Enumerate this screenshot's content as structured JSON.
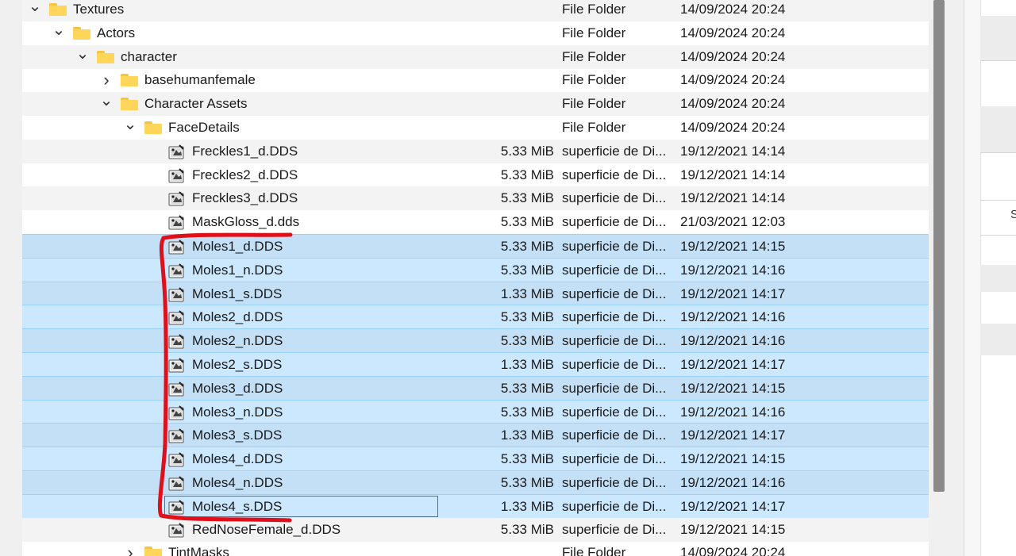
{
  "tree": {
    "rows": [
      {
        "name": "Textures",
        "kind": "folder",
        "indent": 0,
        "chevron": "expanded",
        "size": "",
        "type": "File Folder",
        "date": "14/09/2024 20:24",
        "selected": false
      },
      {
        "name": "Actors",
        "kind": "folder",
        "indent": 1,
        "chevron": "expanded",
        "size": "",
        "type": "File Folder",
        "date": "14/09/2024 20:24",
        "selected": false
      },
      {
        "name": "character",
        "kind": "folder",
        "indent": 2,
        "chevron": "expanded",
        "size": "",
        "type": "File Folder",
        "date": "14/09/2024 20:24",
        "selected": false
      },
      {
        "name": "basehumanfemale",
        "kind": "folder",
        "indent": 3,
        "chevron": "collapsed",
        "size": "",
        "type": "File Folder",
        "date": "14/09/2024 20:24",
        "selected": false
      },
      {
        "name": "Character Assets",
        "kind": "folder",
        "indent": 3,
        "chevron": "expanded",
        "size": "",
        "type": "File Folder",
        "date": "14/09/2024 20:24",
        "selected": false
      },
      {
        "name": "FaceDetails",
        "kind": "folder",
        "indent": 4,
        "chevron": "expanded",
        "size": "",
        "type": "File Folder",
        "date": "14/09/2024 20:24",
        "selected": false
      },
      {
        "name": "Freckles1_d.DDS",
        "kind": "file",
        "indent": 5,
        "chevron": "",
        "size": "5.33 MiB",
        "type": "superficie de Di...",
        "date": "19/12/2021 14:14",
        "selected": false
      },
      {
        "name": "Freckles2_d.DDS",
        "kind": "file",
        "indent": 5,
        "chevron": "",
        "size": "5.33 MiB",
        "type": "superficie de Di...",
        "date": "19/12/2021 14:14",
        "selected": false
      },
      {
        "name": "Freckles3_d.DDS",
        "kind": "file",
        "indent": 5,
        "chevron": "",
        "size": "5.33 MiB",
        "type": "superficie de Di...",
        "date": "19/12/2021 14:14",
        "selected": false
      },
      {
        "name": "MaskGloss_d.dds",
        "kind": "file",
        "indent": 5,
        "chevron": "",
        "size": "5.33 MiB",
        "type": "superficie de Di...",
        "date": "21/03/2021 12:03",
        "selected": false
      },
      {
        "name": "Moles1_d.DDS",
        "kind": "file",
        "indent": 5,
        "chevron": "",
        "size": "5.33 MiB",
        "type": "superficie de Di...",
        "date": "19/12/2021 14:15",
        "selected": true
      },
      {
        "name": "Moles1_n.DDS",
        "kind": "file",
        "indent": 5,
        "chevron": "",
        "size": "5.33 MiB",
        "type": "superficie de Di...",
        "date": "19/12/2021 14:16",
        "selected": true
      },
      {
        "name": "Moles1_s.DDS",
        "kind": "file",
        "indent": 5,
        "chevron": "",
        "size": "1.33 MiB",
        "type": "superficie de Di...",
        "date": "19/12/2021 14:17",
        "selected": true
      },
      {
        "name": "Moles2_d.DDS",
        "kind": "file",
        "indent": 5,
        "chevron": "",
        "size": "5.33 MiB",
        "type": "superficie de Di...",
        "date": "19/12/2021 14:16",
        "selected": true
      },
      {
        "name": "Moles2_n.DDS",
        "kind": "file",
        "indent": 5,
        "chevron": "",
        "size": "5.33 MiB",
        "type": "superficie de Di...",
        "date": "19/12/2021 14:16",
        "selected": true
      },
      {
        "name": "Moles2_s.DDS",
        "kind": "file",
        "indent": 5,
        "chevron": "",
        "size": "1.33 MiB",
        "type": "superficie de Di...",
        "date": "19/12/2021 14:17",
        "selected": true
      },
      {
        "name": "Moles3_d.DDS",
        "kind": "file",
        "indent": 5,
        "chevron": "",
        "size": "5.33 MiB",
        "type": "superficie de Di...",
        "date": "19/12/2021 14:15",
        "selected": true
      },
      {
        "name": "Moles3_n.DDS",
        "kind": "file",
        "indent": 5,
        "chevron": "",
        "size": "5.33 MiB",
        "type": "superficie de Di...",
        "date": "19/12/2021 14:16",
        "selected": true
      },
      {
        "name": "Moles3_s.DDS",
        "kind": "file",
        "indent": 5,
        "chevron": "",
        "size": "1.33 MiB",
        "type": "superficie de Di...",
        "date": "19/12/2021 14:17",
        "selected": true
      },
      {
        "name": "Moles4_d.DDS",
        "kind": "file",
        "indent": 5,
        "chevron": "",
        "size": "5.33 MiB",
        "type": "superficie de Di...",
        "date": "19/12/2021 14:15",
        "selected": true
      },
      {
        "name": "Moles4_n.DDS",
        "kind": "file",
        "indent": 5,
        "chevron": "",
        "size": "5.33 MiB",
        "type": "superficie de Di...",
        "date": "19/12/2021 14:16",
        "selected": true
      },
      {
        "name": "Moles4_s.DDS",
        "kind": "file",
        "indent": 5,
        "chevron": "",
        "size": "1.33 MiB",
        "type": "superficie de Di...",
        "date": "19/12/2021 14:17",
        "selected": true,
        "focused": true
      },
      {
        "name": "RedNoseFemale_d.DDS",
        "kind": "file",
        "indent": 5,
        "chevron": "",
        "size": "5.33 MiB",
        "type": "superficie de Di...",
        "date": "19/12/2021 14:15",
        "selected": false
      },
      {
        "name": "TintMasks",
        "kind": "folder",
        "indent": 4,
        "chevron": "collapsed",
        "size": "",
        "type": "File Folder",
        "date": "14/09/2024 20:24",
        "selected": false
      }
    ]
  },
  "right_pane": {
    "partial_label": "S"
  },
  "colors": {
    "selection": "#cce8ff",
    "selection_border": "#99d1ff",
    "annotation": "#e0101a",
    "folder": "#ffd65a"
  },
  "icons": {
    "folder": "folder-icon",
    "file": "gimp-image-icon",
    "expanded": "chevron-down-icon",
    "collapsed": "chevron-right-icon"
  }
}
